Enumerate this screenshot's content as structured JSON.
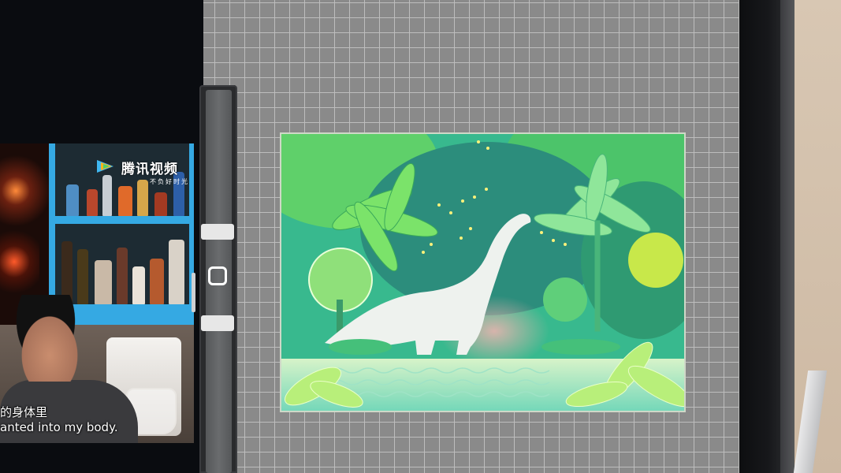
{
  "video": {
    "watermark": {
      "title": "腾讯视频",
      "subtitle": "不负好时光"
    },
    "subtitle_zh": "的身体里",
    "subtitle_en": "anted into my body."
  },
  "side_handle": {
    "up_icon": "minus-bar-icon",
    "center_icon": "rounded-square-icon",
    "down_icon": "minus-bar-icon"
  },
  "artwork": {
    "icon": "dinosaur-jungle-illustration",
    "colors": {
      "sky": "#46c6a0",
      "water": "#b6e9c9",
      "dinosaur": "#e9efe9",
      "leaf": "#6cd35f",
      "glow": "#f6e96a"
    }
  },
  "canvas": {
    "grid_color": "#bdbdbd",
    "background": "#8a8a8a"
  }
}
